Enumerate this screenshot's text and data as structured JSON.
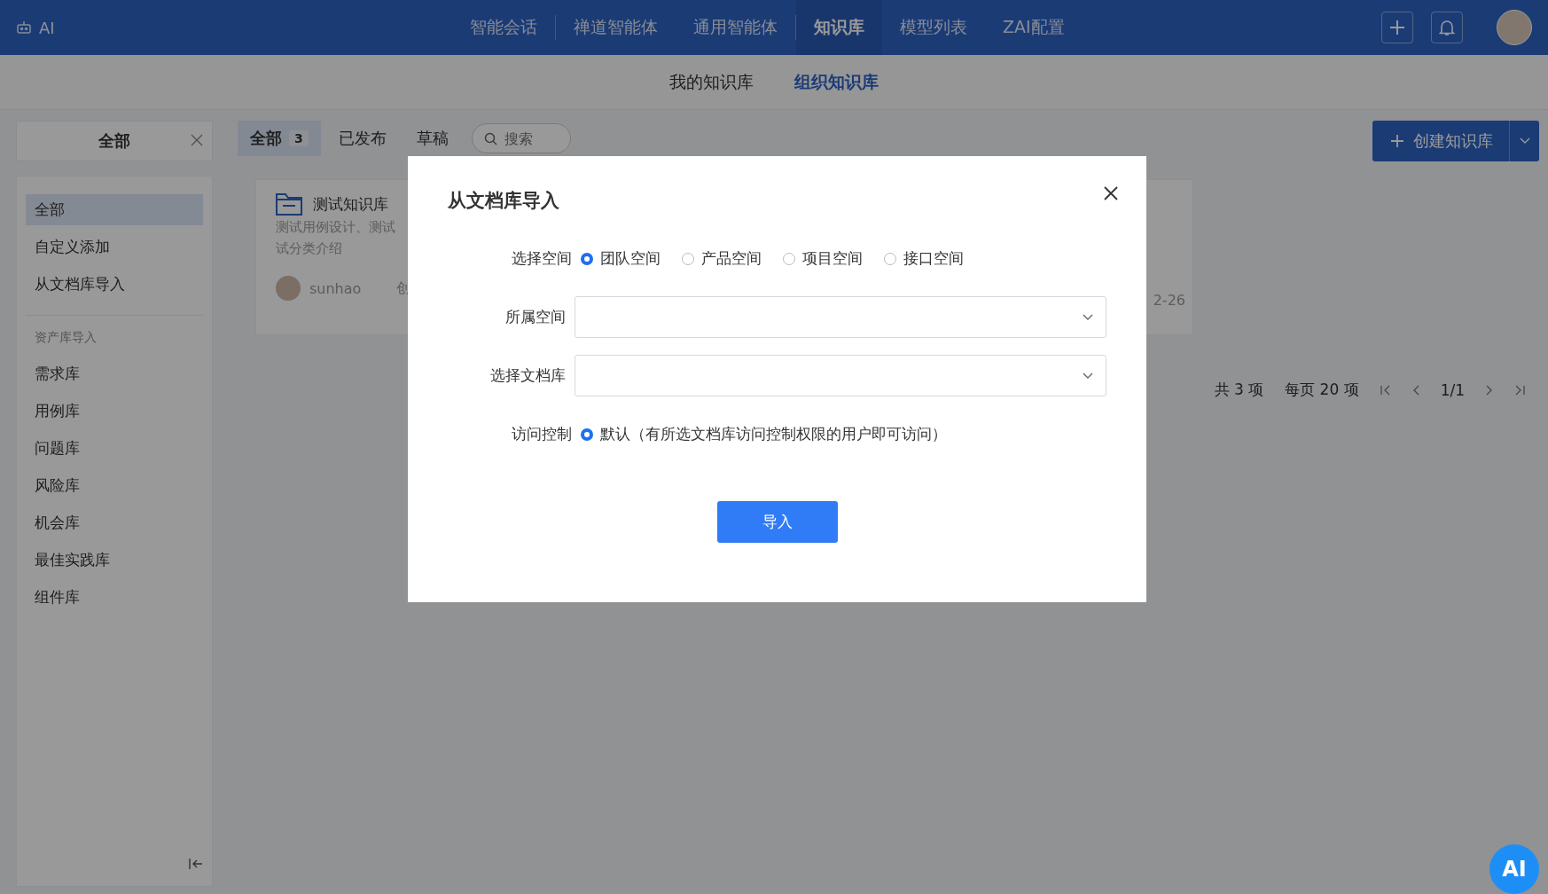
{
  "app": {
    "logo_text": "AI"
  },
  "nav": [
    {
      "label": "智能会话",
      "selected": false
    },
    {
      "label": "禅道智能体",
      "selected": false
    },
    {
      "label": "通用智能体",
      "selected": false
    },
    {
      "label": "知识库",
      "selected": true
    },
    {
      "label": "模型列表",
      "selected": false
    },
    {
      "label": "ZAI配置",
      "selected": false
    }
  ],
  "subtabs": [
    {
      "label": "我的知识库",
      "selected": false
    },
    {
      "label": "组织知识库",
      "selected": true
    }
  ],
  "filter": {
    "label": "全部"
  },
  "status_tabs": [
    {
      "label": "全部",
      "count": "3",
      "selected": true
    },
    {
      "label": "已发布",
      "selected": false
    },
    {
      "label": "草稿",
      "selected": false
    }
  ],
  "search": {
    "placeholder": "搜索"
  },
  "create_button": {
    "label": "创建知识库"
  },
  "sidebar": {
    "items": [
      {
        "label": "全部",
        "selected": true
      },
      {
        "label": "自定义添加",
        "selected": false
      },
      {
        "label": "从文档库导入",
        "selected": false
      }
    ],
    "section_title": "资产库导入",
    "section_items": [
      {
        "label": "需求库",
        "selected": false
      },
      {
        "label": "用例库",
        "selected": false
      },
      {
        "label": "问题库",
        "selected": false
      },
      {
        "label": "风险库",
        "selected": false
      },
      {
        "label": "机会库",
        "selected": false
      },
      {
        "label": "最佳实践库",
        "selected": false
      },
      {
        "label": "组件库",
        "selected": false
      }
    ]
  },
  "card": {
    "title": "测试知识库",
    "description_lines": [
      "测试用例设计、测试",
      "试分类介绍"
    ],
    "author": "sunhao",
    "created": "创",
    "date": "2-26"
  },
  "pagination": {
    "total": "共 3 项",
    "page_size": "每页 20 项",
    "page": "1/1"
  },
  "dialog": {
    "title": "从文档库导入",
    "fields": [
      {
        "kind": "radio",
        "label": "选择空间",
        "options": [
          {
            "label": "团队空间",
            "selected": true
          },
          {
            "label": "产品空间",
            "selected": false
          },
          {
            "label": "项目空间",
            "selected": false
          },
          {
            "label": "接口空间",
            "selected": false
          }
        ]
      },
      {
        "kind": "select",
        "label": "所属空间"
      },
      {
        "kind": "select",
        "label": "选择文档库"
      },
      {
        "kind": "radio",
        "label": "访问控制",
        "options": [
          {
            "label": "默认（有所选文档库访问控制权限的用户即可访问）",
            "selected": true
          }
        ]
      }
    ],
    "submit": "导入"
  },
  "assistant_badge": {
    "label": "AI"
  }
}
